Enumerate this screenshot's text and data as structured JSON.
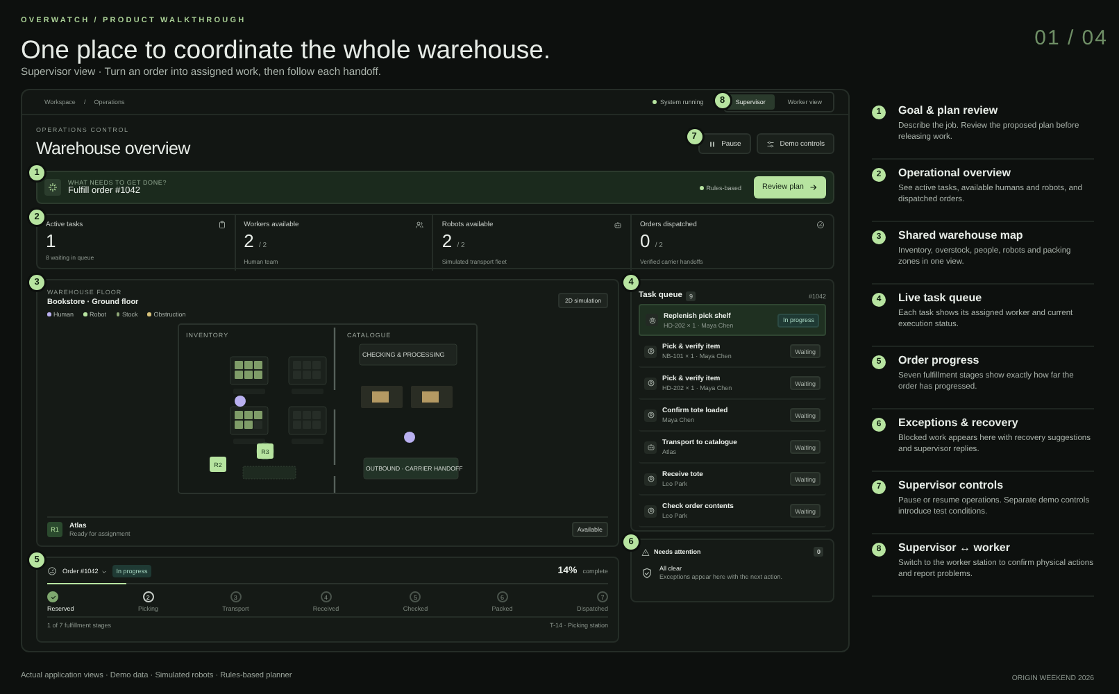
{
  "header": {
    "kicker": "OVERWATCH / PRODUCT WALKTHROUGH",
    "title": "One place to coordinate the whole warehouse.",
    "subtitle": "Supervisor view · Turn an order into assigned work, then follow each handoff.",
    "page_counter": "01 / 04"
  },
  "app": {
    "breadcrumbs": [
      "Workspace",
      "Operations"
    ],
    "breadcrumb_separator": "/",
    "system_status": "System running",
    "view_callout": "8",
    "view_tabs": [
      {
        "label": "Supervisor",
        "selected": true
      },
      {
        "label": "Worker view",
        "selected": false
      }
    ],
    "kicker": "OPERATIONS CONTROL",
    "title": "Warehouse overview",
    "actions_callout": "7",
    "actions": [
      {
        "label": "Pause",
        "kind": "pause"
      },
      {
        "label": "Demo controls",
        "kind": "settings"
      }
    ],
    "goal": {
      "callout": "1",
      "kicker": "WHAT NEEDS TO GET DONE?",
      "text": "Fulfill order #1042",
      "planner": "Rules-based",
      "button": "Review plan"
    },
    "stats_callout": "2",
    "stats": [
      {
        "label": "Active tasks",
        "value": "1",
        "sub": "8 waiting in queue"
      },
      {
        "label": "Workers available",
        "value": "2",
        "total": "/ 2",
        "sub": "Human team"
      },
      {
        "label": "Robots available",
        "value": "2",
        "total": "/ 2",
        "sub": "Simulated transport fleet"
      },
      {
        "label": "Orders dispatched",
        "value": "0",
        "total": "/ 2",
        "sub": "Verified carrier handoffs"
      }
    ],
    "map": {
      "callout": "3",
      "kicker": "WAREHOUSE FLOOR",
      "title": "Bookstore · Ground floor",
      "mode_button": "2D simulation",
      "legend": [
        {
          "label": "Human",
          "color": "#b9b0f0"
        },
        {
          "label": "Robot",
          "color": "#b7e4a0"
        },
        {
          "label": "Stock",
          "color": "#8fa878"
        },
        {
          "label": "Obstruction",
          "color": "#d8c27a"
        }
      ],
      "zones": [
        "INVENTORY",
        "CATALOGUE"
      ],
      "stations": [
        "CHECKING & PROCESSING",
        "OUTBOUND · CARRIER HANDOFF"
      ],
      "robots": [
        "R2",
        "R3"
      ],
      "robot_card": {
        "badge": "R1",
        "name": "Atlas",
        "status": "Ready for assignment",
        "tag": "Available"
      }
    },
    "task_queue": {
      "callout": "4",
      "title": "Task queue",
      "count": "9",
      "order": "#1042",
      "tasks": [
        {
          "title": "Replenish pick shelf",
          "sub": "HD-202 × 1 · Maya Chen",
          "status": "In progress",
          "active": true,
          "kind": "human"
        },
        {
          "title": "Pick & verify item",
          "sub": "NB-101 × 1 · Maya Chen",
          "status": "Waiting",
          "active": false,
          "kind": "human"
        },
        {
          "title": "Pick & verify item",
          "sub": "HD-202 × 1 · Maya Chen",
          "status": "Waiting",
          "active": false,
          "kind": "human"
        },
        {
          "title": "Confirm tote loaded",
          "sub": "Maya Chen",
          "status": "Waiting",
          "active": false,
          "kind": "human"
        },
        {
          "title": "Transport to catalogue",
          "sub": "Atlas",
          "status": "Waiting",
          "active": false,
          "kind": "robot"
        },
        {
          "title": "Receive tote",
          "sub": "Leo Park",
          "status": "Waiting",
          "active": false,
          "kind": "human"
        },
        {
          "title": "Check order contents",
          "sub": "Leo Park",
          "status": "Waiting",
          "active": false,
          "kind": "human"
        }
      ]
    },
    "attention": {
      "callout": "6",
      "title": "Needs attention",
      "count": "0",
      "status": "All clear",
      "note": "Exceptions appear here with the next action."
    },
    "order": {
      "callout": "5",
      "label": "Order #1042",
      "status": "In progress",
      "percent": "14%",
      "percent_label": "complete",
      "level": 0.14,
      "steps": [
        {
          "label": "Reserved",
          "done": true,
          "current": false
        },
        {
          "label": "Picking",
          "number": "2",
          "done": false,
          "current": true
        },
        {
          "label": "Transport",
          "number": "3",
          "done": false,
          "current": false
        },
        {
          "label": "Received",
          "number": "4",
          "done": false,
          "current": false
        },
        {
          "label": "Checked",
          "number": "5",
          "done": false,
          "current": false
        },
        {
          "label": "Packed",
          "number": "6",
          "done": false,
          "current": false
        },
        {
          "label": "Dispatched",
          "number": "7",
          "done": false,
          "current": false
        }
      ],
      "stages": "1 of 7 fulfillment stages",
      "location": "T-14 · Picking station"
    }
  },
  "guide": [
    {
      "number": "1",
      "title": "Goal & plan review",
      "text": "Describe the job. Review the proposed plan before releasing work."
    },
    {
      "number": "2",
      "title": "Operational overview",
      "text": "See active tasks, available humans and robots, and dispatched orders."
    },
    {
      "number": "3",
      "title": "Shared warehouse map",
      "text": "Inventory, overstock, people, robots and packing zones in one view."
    },
    {
      "number": "4",
      "title": "Live task queue",
      "text": "Each task shows its assigned worker and current execution status."
    },
    {
      "number": "5",
      "title": "Order progress",
      "text": "Seven fulfillment stages show exactly how far the order has progressed."
    },
    {
      "number": "6",
      "title": "Exceptions & recovery",
      "text": "Blocked work appears here with recovery suggestions and supervisor replies."
    },
    {
      "number": "7",
      "title": "Supervisor controls",
      "text": "Pause or resume operations. Separate demo controls introduce test conditions."
    },
    {
      "number": "8",
      "title": "Supervisor ↔ worker",
      "text": "Switch to the worker station to confirm physical actions and report problems."
    }
  ],
  "footer": {
    "note": "Actual application views · Demo data · Simulated robots · Rules-based planner",
    "event": "ORIGIN WEEKEND 2026"
  }
}
